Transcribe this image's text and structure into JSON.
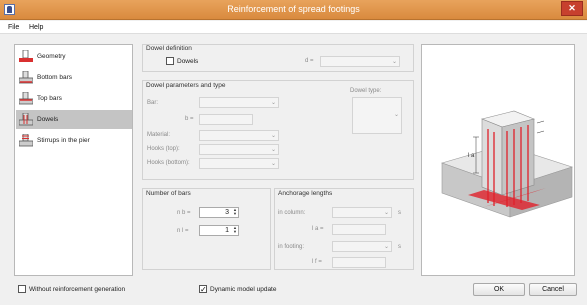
{
  "window": {
    "title": "Reinforcement of spread footings",
    "close": "✕"
  },
  "menu": {
    "file": "File",
    "help": "Help"
  },
  "sidebar": {
    "items": [
      {
        "label": "Geometry",
        "icon": "geometry-icon",
        "active": false
      },
      {
        "label": "Bottom bars",
        "icon": "bottom-bars-icon",
        "active": false
      },
      {
        "label": "Top bars",
        "icon": "top-bars-icon",
        "active": false
      },
      {
        "label": "Dowels",
        "icon": "dowels-icon",
        "active": true
      },
      {
        "label": "Stirrups in the pier",
        "icon": "stirrups-icon",
        "active": false
      }
    ]
  },
  "dowel_definition": {
    "title": "Dowel definition",
    "dowels_label": "Dowels",
    "dowels_checked": false,
    "d_label": "d ="
  },
  "dowel_params": {
    "title": "Dowel parameters and type",
    "bar_label": "Bar:",
    "b_label": "b =",
    "material_label": "Material:",
    "hooks_top_label": "Hooks (top):",
    "hooks_bottom_label": "Hooks (bottom):",
    "dowel_type_label": "Dowel type:"
  },
  "number_of_bars": {
    "title": "Number of bars",
    "nb_label": "n b =",
    "nl_label": "n l =",
    "nb_value": "3",
    "nl_value": "1"
  },
  "anchorage": {
    "title": "Anchorage lengths",
    "in_column_label": "in column:",
    "la_label": "l a =",
    "in_footing_label": "in footing:",
    "lf_label": "l f =",
    "unit": "s"
  },
  "footer": {
    "without_reinf_label": "Without reinforcement generation",
    "without_reinf_checked": false,
    "dynamic_update_label": "Dynamic model update",
    "dynamic_update_checked": true,
    "ok": "OK",
    "cancel": "Cancel"
  },
  "preview": {
    "dimension_label": "l a"
  },
  "colors": {
    "titlebar": "#dc8f45",
    "rebar": "#e0202a",
    "active_item": "#c4c4c4"
  }
}
